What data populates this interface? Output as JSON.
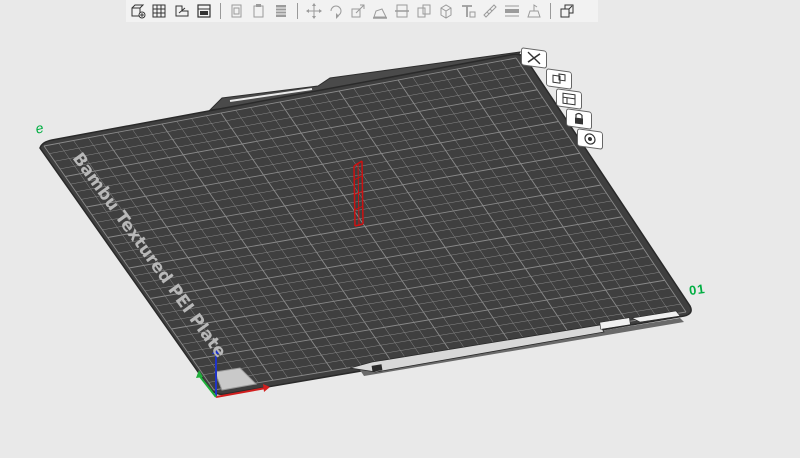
{
  "toolbar": {
    "groups": [
      [
        "add-object-icon",
        "arrange-icon",
        "auto-orient-icon",
        "layout-icon"
      ],
      [
        "copy-icon",
        "paste-icon",
        "delete-icon"
      ],
      [
        "move-icon",
        "rotate-icon",
        "scale-icon",
        "lay-on-face-icon",
        "cut-icon",
        "split-to-objects-icon",
        "split-to-parts-icon",
        "text-icon",
        "measure-icon",
        "variable-layer-icon",
        "support-paint-icon"
      ],
      [
        "assembly-view-icon"
      ]
    ]
  },
  "plate": {
    "label": "Bambu Textured PEI Plate",
    "number": "01",
    "color": "#3f3f3f",
    "grid_color": "#8a8a8a",
    "buttons": [
      "close-plate-icon",
      "arrange-plate-icon",
      "plate-settings-icon",
      "lock-plate-icon",
      "plate-view-icon"
    ]
  },
  "model": {
    "color": "#cc1111"
  },
  "axes": {
    "x_color": "#d21f1f",
    "y_color": "#1fae3a",
    "z_color": "#1f33c8"
  },
  "marker_color": "#00ae42"
}
